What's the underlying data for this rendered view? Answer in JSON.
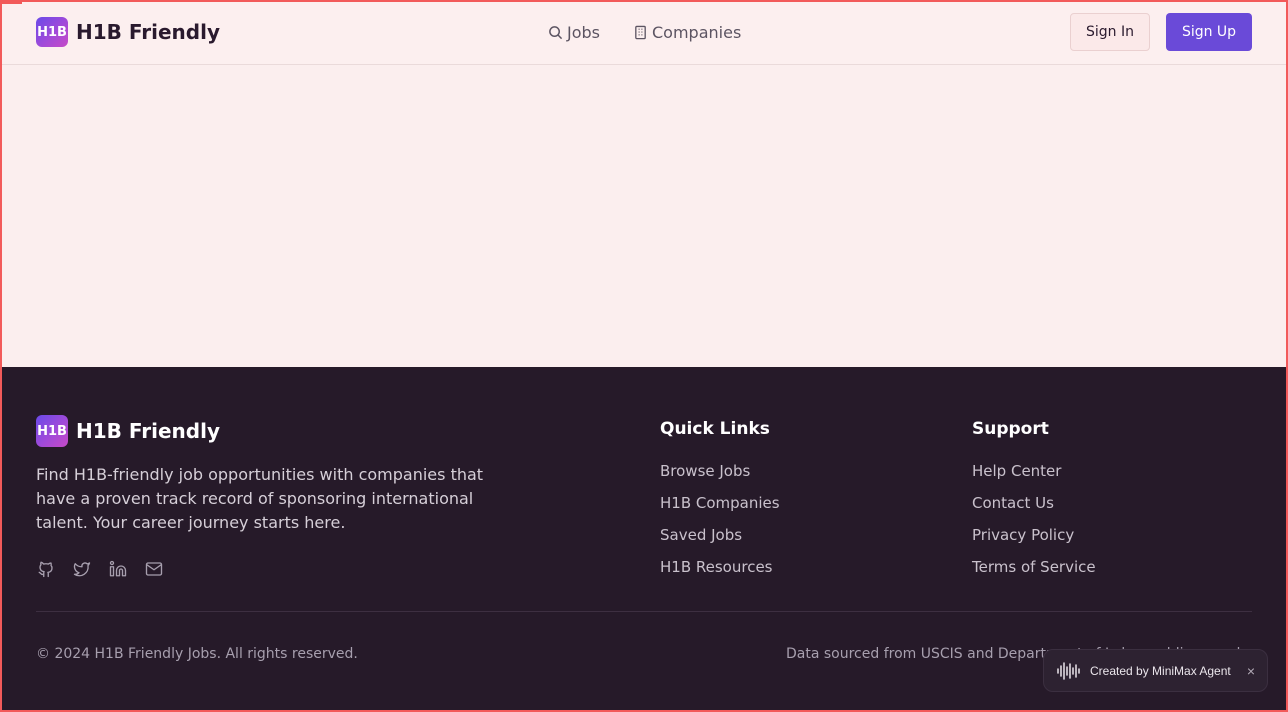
{
  "header": {
    "logo_mark": "H1B",
    "logo_text": "H1B Friendly",
    "nav": {
      "jobs": "Jobs",
      "companies": "Companies"
    },
    "sign_in": "Sign In",
    "sign_up": "Sign Up"
  },
  "footer": {
    "logo_mark": "H1B",
    "logo_text": "H1B Friendly",
    "description": "Find H1B-friendly job opportunities with companies that have a proven track record of sponsoring international talent. Your career journey starts here.",
    "social_icons": [
      "github-icon",
      "twitter-icon",
      "linkedin-icon",
      "mail-icon"
    ],
    "quick_links": {
      "title": "Quick Links",
      "items": [
        "Browse Jobs",
        "H1B Companies",
        "Saved Jobs",
        "H1B Resources"
      ]
    },
    "support": {
      "title": "Support",
      "items": [
        "Help Center",
        "Contact Us",
        "Privacy Policy",
        "Terms of Service"
      ]
    },
    "copyright": "© 2024 H1B Friendly Jobs. All rights reserved.",
    "data_source": "Data sourced from USCIS and Department of Labor public records"
  },
  "agent_badge": {
    "label": "Created by MiniMax Agent",
    "close": "×"
  },
  "colors": {
    "brand_primary": "#6a4ad8",
    "page_background": "#fbeeee",
    "footer_background": "#261a29"
  }
}
